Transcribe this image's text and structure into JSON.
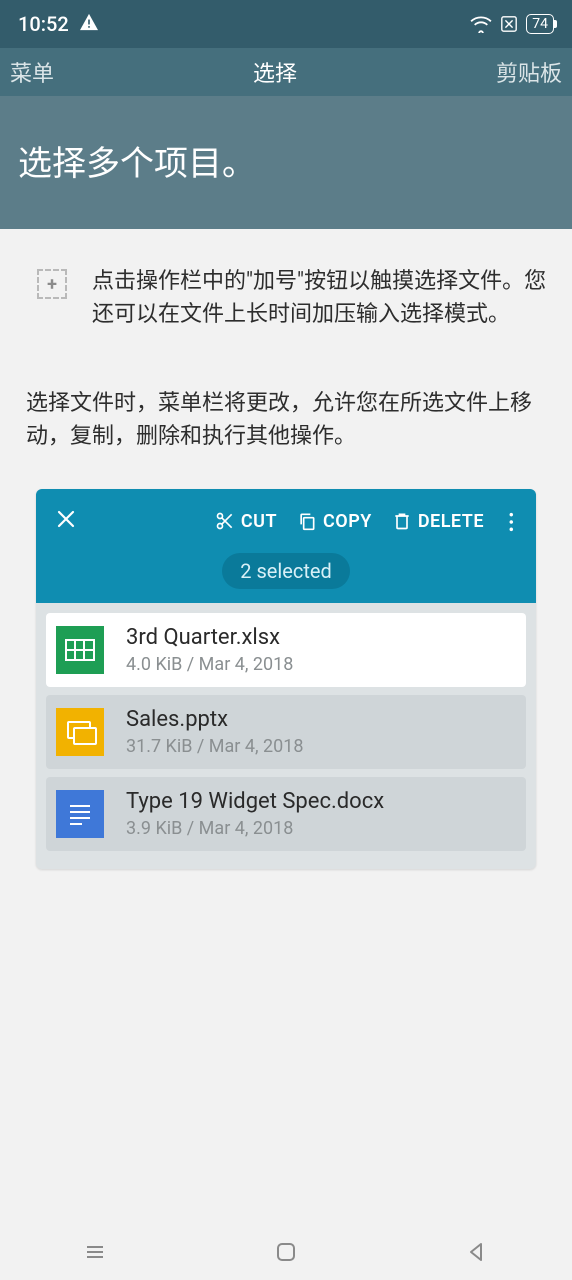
{
  "status": {
    "time": "10:52",
    "battery": "74"
  },
  "nav": {
    "left": "菜单",
    "center": "选择",
    "right": "剪贴板"
  },
  "banner": "选择多个项目。",
  "hint": "点击操作栏中的\"加号\"按钮以触摸选择文件。您还可以在文件上长时间加压输入选择模式。",
  "paragraph": "选择文件时，菜单栏将更改，允许您在所选文件上移动，复制，删除和执行其他操作。",
  "toolbar": {
    "cut": "CUT",
    "copy": "COPY",
    "delete": "DELETE",
    "selected": "2 selected"
  },
  "files": [
    {
      "name": "3rd Quarter.xlsx",
      "meta": "4.0 KiB / Mar 4, 2018",
      "type": "sheet",
      "selected": false
    },
    {
      "name": "Sales.pptx",
      "meta": "31.7 KiB / Mar 4, 2018",
      "type": "slides",
      "selected": true
    },
    {
      "name": "Type 19 Widget Spec.docx",
      "meta": "3.9 KiB / Mar 4, 2018",
      "type": "doc",
      "selected": true
    }
  ]
}
